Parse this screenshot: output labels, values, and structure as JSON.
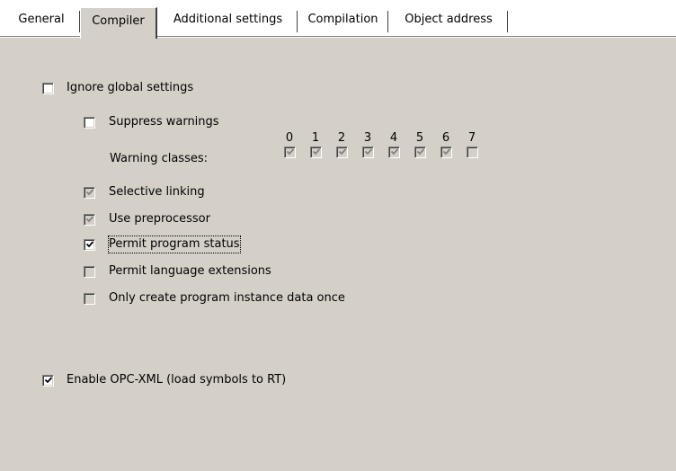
{
  "tabs": [
    {
      "label": "General",
      "active": false
    },
    {
      "label": "Compiler",
      "active": true
    },
    {
      "label": "Additional settings",
      "active": false
    },
    {
      "label": "Compilation",
      "active": false
    },
    {
      "label": "Object address",
      "active": false
    }
  ],
  "options": {
    "ignore_global": {
      "label": "Ignore global settings",
      "checked": false,
      "enabled": true
    },
    "suppress_warnings": {
      "label": "Suppress warnings",
      "checked": false,
      "enabled": true
    },
    "warning_classes_label": "Warning classes:",
    "warning_classes": [
      {
        "num": "0",
        "checked": true
      },
      {
        "num": "1",
        "checked": true
      },
      {
        "num": "2",
        "checked": true
      },
      {
        "num": "3",
        "checked": true
      },
      {
        "num": "4",
        "checked": true
      },
      {
        "num": "5",
        "checked": true
      },
      {
        "num": "6",
        "checked": true
      },
      {
        "num": "7",
        "checked": false
      }
    ],
    "selective_linking": {
      "label": "Selective linking",
      "checked": true,
      "enabled": false
    },
    "use_preprocessor": {
      "label": "Use preprocessor",
      "checked": true,
      "enabled": false
    },
    "permit_program_status": {
      "label": "Permit program status",
      "checked": true,
      "enabled": true
    },
    "permit_language_extensions": {
      "label": "Permit language extensions",
      "checked": false,
      "enabled": false
    },
    "only_create_instance_once": {
      "label": "Only create program instance data once",
      "checked": false,
      "enabled": false
    },
    "enable_opc_xml": {
      "label": "Enable OPC-XML (load symbols to RT)",
      "checked": true,
      "enabled": true
    }
  },
  "colors": {
    "dialog_bg": "#d4d0c8",
    "check_enabled": "#000000",
    "check_disabled": "#808080"
  }
}
